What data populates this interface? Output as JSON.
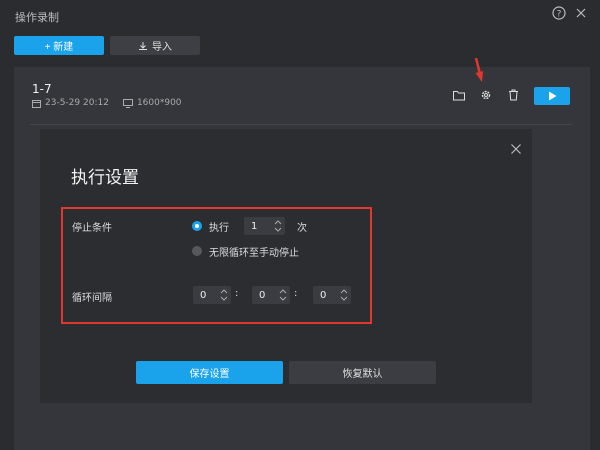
{
  "window": {
    "title": "操作录制"
  },
  "toolbar": {
    "new_label": "+ 新建",
    "import_label": "导入"
  },
  "task": {
    "name": "1-7",
    "date": "23-5-29  20:12",
    "resolution": "1600*900"
  },
  "dialog": {
    "title": "执行设置",
    "stop_condition_label": "停止条件",
    "execute_label": "执行",
    "execute_count": "1",
    "times_unit": "次",
    "infinite_label": "无限循环至手动停止",
    "interval_label": "循环间隔",
    "interval_h": "0",
    "interval_m": "0",
    "interval_s": "0",
    "sep1": ":",
    "sep2": ":",
    "save_label": "保存设置",
    "reset_label": "恢复默认"
  },
  "colors": {
    "accent": "#1aa3ea",
    "highlight": "#e0382f"
  }
}
